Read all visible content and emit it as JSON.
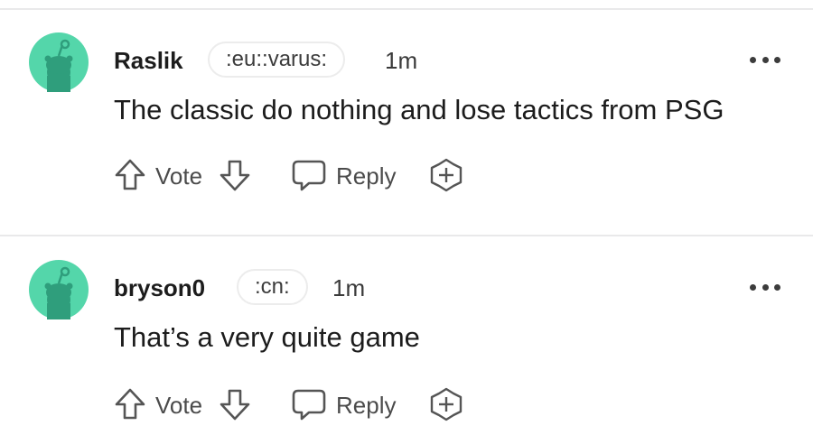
{
  "comments": [
    {
      "username": "Raslik",
      "flair": ":eu::varus:",
      "time": "1m",
      "body": "The classic do nothing and lose tactics from PSG",
      "vote_label": "Vote",
      "reply_label": "Reply"
    },
    {
      "username": "bryson0",
      "flair": ":cn:",
      "time": "1m",
      "body": "That’s a very quite game",
      "vote_label": "Vote",
      "reply_label": "Reply"
    }
  ],
  "colors": {
    "avatar_bg": "#54d6aa",
    "avatar_figure": "#2f9e7c",
    "icon_stroke": "#555555",
    "divider": "#e9e9ea"
  },
  "icons": {
    "upvote": "arrow-up-outline",
    "downvote": "arrow-down-outline",
    "reply": "speech-bubble-outline",
    "award": "plus-circle-outline",
    "more": "horizontal-ellipsis"
  }
}
